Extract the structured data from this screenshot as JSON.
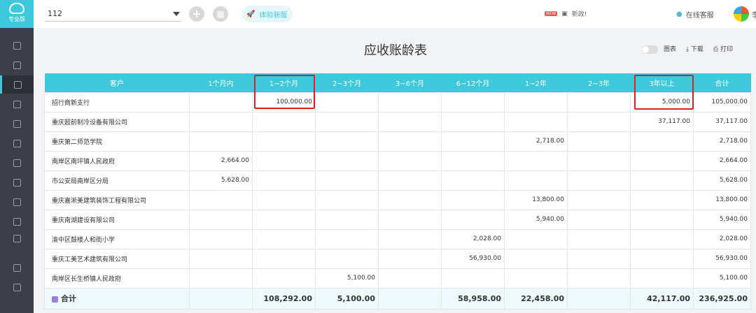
{
  "sidebar": {
    "logo_label": "专业版",
    "items": [
      "list",
      "ledger",
      "chart",
      "building",
      "calendar",
      "report",
      "tools",
      "money",
      "stack",
      "copy",
      "settings",
      "media",
      "gauge"
    ],
    "active_index": 2
  },
  "topbar": {
    "account": "112",
    "new_version": "体验新版",
    "news_badge": "NEW",
    "news": "新政!",
    "service": "在线客服",
    "user": "李"
  },
  "page": {
    "title": "应收账龄表",
    "chart_toggle": "图表",
    "download": "下载",
    "print": "打印"
  },
  "table": {
    "headers": [
      "客户",
      "1个月内",
      "1~2个月",
      "2~3个月",
      "3~6个月",
      "6~12个月",
      "1~2年",
      "2~3年",
      "3年以上",
      "合计"
    ],
    "rows": [
      [
        "招行商新支行",
        "",
        "100,000.00",
        "",
        "",
        "",
        "",
        "",
        "5,000.00",
        "105,000.00"
      ],
      [
        "重庆超前制冷设备有限公司",
        "",
        "",
        "",
        "",
        "",
        "",
        "",
        "37,117.00",
        "37,117.00"
      ],
      [
        "重庆第二师范学院",
        "",
        "",
        "",
        "",
        "",
        "2,718.00",
        "",
        "",
        "2,718.00"
      ],
      [
        "南岸区南坪镇人民政府",
        "2,664.00",
        "",
        "",
        "",
        "",
        "",
        "",
        "",
        "2,664.00"
      ],
      [
        "市公安局南岸区分局",
        "5,628.00",
        "",
        "",
        "",
        "",
        "",
        "",
        "",
        "5,628.00"
      ],
      [
        "重庆嘉淅美建筑装饰工程有限公司",
        "",
        "",
        "",
        "",
        "",
        "13,800.00",
        "",
        "",
        "13,800.00"
      ],
      [
        "重庆南湖建设有限公司",
        "",
        "",
        "",
        "",
        "",
        "5,940.00",
        "",
        "",
        "5,940.00"
      ],
      [
        "渝中区鼓楼人和街小学",
        "",
        "",
        "",
        "",
        "2,028.00",
        "",
        "",
        "",
        "2,028.00"
      ],
      [
        "重庆工美艺术建筑有限公司",
        "",
        "",
        "",
        "",
        "56,930.00",
        "",
        "",
        "",
        "56,930.00"
      ],
      [
        "南岸区长生桥镇人民政府",
        "",
        "",
        "5,100.00",
        "",
        "",
        "",
        "",
        "",
        "5,100.00"
      ]
    ],
    "total": [
      "合计",
      "",
      "108,292.00",
      "5,100.00",
      "",
      "58,958.00",
      "22,458.00",
      "",
      "42,117.00",
      "236,925.00"
    ]
  }
}
